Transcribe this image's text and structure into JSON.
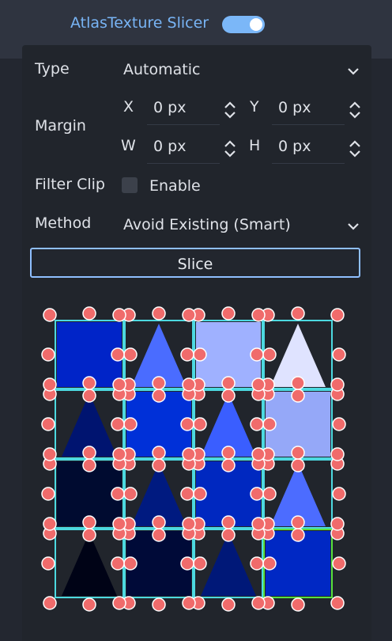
{
  "header": {
    "title": "AtlasTexture Slicer",
    "toggle_on": true,
    "toggle_color": "#7bb7f8",
    "title_color": "#78b4f5"
  },
  "type": {
    "label": "Type",
    "value": "Automatic",
    "icon": "chevron-down-icon"
  },
  "margin": {
    "label": "Margin",
    "x": {
      "axis": "X",
      "value": "0 px"
    },
    "y": {
      "axis": "Y",
      "value": "0 px"
    },
    "w": {
      "axis": "W",
      "value": "0 px"
    },
    "h": {
      "axis": "H",
      "value": "0 px"
    }
  },
  "filter_clip": {
    "label": "Filter Clip",
    "checkbox_label": "Enable",
    "checked": false
  },
  "method": {
    "label": "Method",
    "value": "Avoid Existing (Smart)",
    "icon": "chevron-down-icon"
  },
  "slice_button": {
    "label": "Slice"
  },
  "atlas_preview": {
    "rows": 4,
    "cols": 4,
    "tiles": [
      [
        {
          "shape": "square",
          "color": "#0024c8"
        },
        {
          "shape": "triangle",
          "color": "#4a6cff"
        },
        {
          "shape": "square",
          "color": "#9fb1ff"
        },
        {
          "shape": "triangle",
          "color": "#dfe3ff"
        }
      ],
      [
        {
          "shape": "triangle",
          "color": "#001470"
        },
        {
          "shape": "square",
          "color": "#0030d8"
        },
        {
          "shape": "triangle",
          "color": "#3a5eff"
        },
        {
          "shape": "square",
          "color": "#95a8f8"
        }
      ],
      [
        {
          "shape": "square",
          "color": "#000b30"
        },
        {
          "shape": "triangle",
          "color": "#001a80"
        },
        {
          "shape": "square",
          "color": "#0028c0"
        },
        {
          "shape": "triangle",
          "color": "#4c6cff"
        }
      ],
      [
        {
          "shape": "triangle",
          "color": "#000316"
        },
        {
          "shape": "square",
          "color": "#000a38"
        },
        {
          "shape": "triangle",
          "color": "#001878"
        },
        {
          "shape": "square",
          "color": "#0028c4"
        }
      ]
    ],
    "selected": {
      "row": 3,
      "col": 3
    },
    "border_color": "#4cd9e0",
    "selected_border_color": "#58e040",
    "handle_color": "#f06b6b"
  }
}
